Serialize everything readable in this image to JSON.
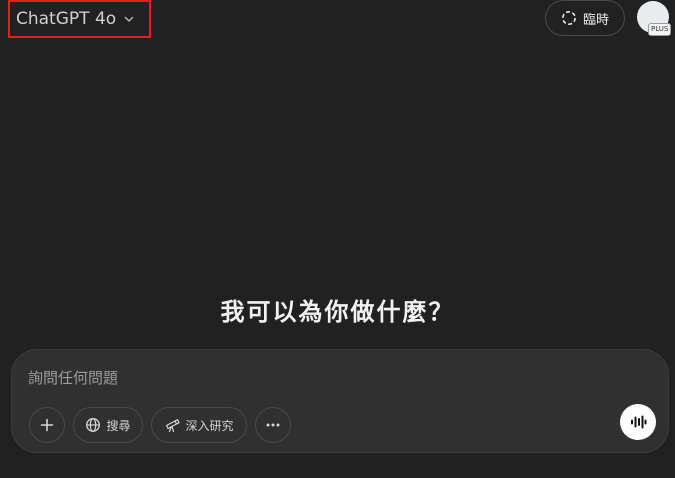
{
  "header": {
    "model_name": "ChatGPT 4o",
    "temporary_chat_label": "臨時",
    "plan_badge": "PLUS"
  },
  "main": {
    "heading": "我可以為你做什麼？"
  },
  "composer": {
    "placeholder": "詢問任何問題",
    "value": "",
    "tools": {
      "search_label": "搜尋",
      "deep_research_label": "深入研究"
    }
  },
  "icons": {
    "model_chevron": "chevron-down-icon",
    "temporary_chat": "dashed-circle-icon",
    "attach": "plus-icon",
    "search": "globe-icon",
    "deep_research": "telescope-icon",
    "more": "more-horizontal-icon",
    "voice": "voice-waveform-icon"
  },
  "colors": {
    "background": "#212121",
    "composer_background": "#303030",
    "highlight_box": "#e0201f",
    "voice_button": "#ffffff"
  }
}
